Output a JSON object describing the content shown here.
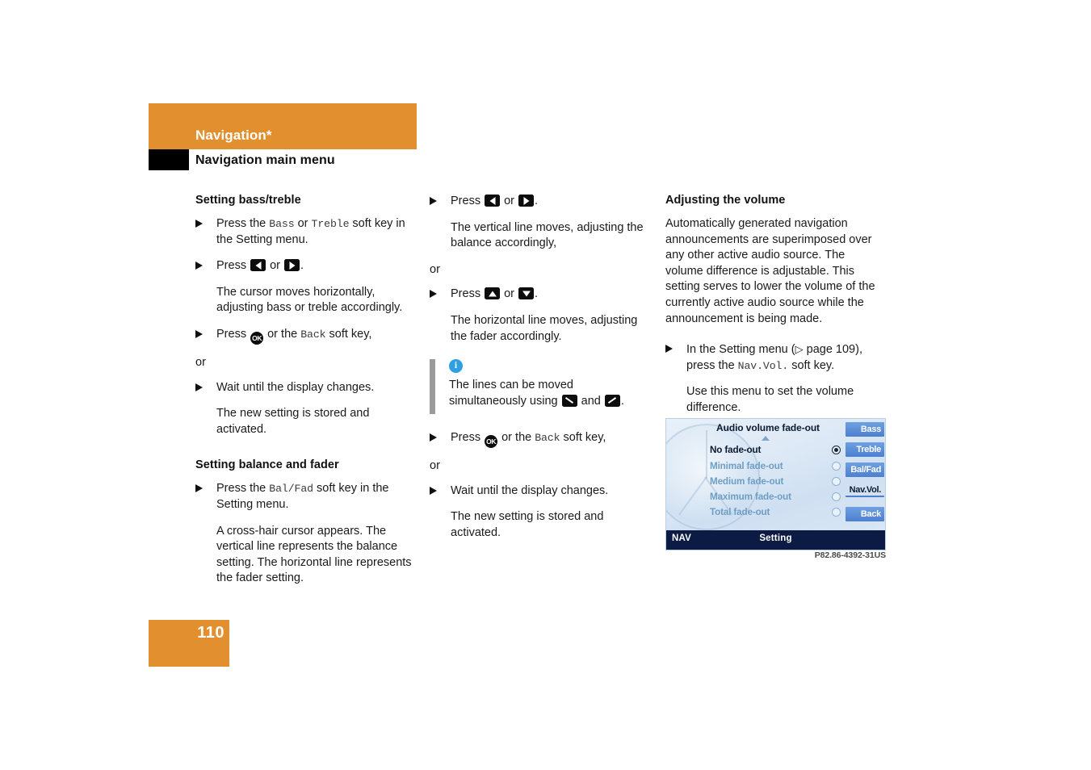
{
  "header": {
    "chapter": "Navigation*",
    "subtitle": "Navigation main menu"
  },
  "column1": {
    "section1_title": "Setting bass/treble",
    "s1_step1_pre": "Press the ",
    "s1_step1_key1": "Bass",
    "s1_step1_mid": " or ",
    "s1_step1_key2": "Treble",
    "s1_step1_post": " soft key in the Setting menu.",
    "s1_step2_pre": "Press ",
    "s1_step2_mid": " or ",
    "s1_step2_post": ".",
    "s1_result1": "The cursor moves horizontally, adjusting bass or treble accordingly.",
    "s1_step3_pre": "Press ",
    "s1_step3_mid": " or the ",
    "s1_step3_key": "Back",
    "s1_step3_post": " soft key,",
    "s1_or": "or",
    "s1_step4": "Wait until the display changes.",
    "s1_result2": "The new setting is stored and activated.",
    "section2_title": "Setting balance and fader",
    "s2_step1_pre": "Press the ",
    "s2_step1_key": "Bal/Fad",
    "s2_step1_post": " soft key in the Setting menu.",
    "s2_result1": "A cross-hair cursor appears. The vertical line represents the balance setting. The horizontal line represents the fader setting."
  },
  "column2": {
    "step1_pre": "Press ",
    "step1_mid": " or ",
    "step1_post": ".",
    "result1": "The vertical line moves, adjusting the balance accordingly,",
    "or1": "or",
    "step2_pre": "Press ",
    "step2_mid": " or ",
    "step2_post": ".",
    "result2": "The horizontal line moves, adjusting the fader accordingly.",
    "info_icon": "i",
    "info_pre": "The lines can be moved simultaneously using ",
    "info_mid": " and ",
    "info_post": ".",
    "step3_pre": "Press ",
    "step3_mid": " or the ",
    "step3_key": "Back",
    "step3_post": " soft key,",
    "or2": "or",
    "step4": "Wait until the display changes.",
    "result3": "The new setting is stored and activated."
  },
  "column3": {
    "section_title": "Adjusting the volume",
    "intro": "Automatically generated navigation announcements are superimposed over any other active audio source. The volume difference is adjustable. This setting serves to lower the volume of the currently active audio source while the announcement is being made.",
    "step1_pre": "In the Setting menu (",
    "step1_refarrow": "▷",
    "step1_ref": " page 109), press the ",
    "step1_key": "Nav.Vol.",
    "step1_post": " soft key.",
    "result1": "Use this menu to set the volume difference."
  },
  "nav_screen": {
    "title": "Audio volume fade-out",
    "options": [
      {
        "label": "No fade-out",
        "selected": true
      },
      {
        "label": "Minimal fade-out",
        "selected": false
      },
      {
        "label": "Medium fade-out",
        "selected": false
      },
      {
        "label": "Maximum fade-out",
        "selected": false
      },
      {
        "label": "Total fade-out",
        "selected": false
      }
    ],
    "softkeys": [
      {
        "label": "Bass",
        "active": false
      },
      {
        "label": "Treble",
        "active": false
      },
      {
        "label": "Bal/Fad",
        "active": false
      },
      {
        "label": "Nav.Vol.",
        "active": true
      },
      {
        "label": "Back",
        "active": false
      }
    ],
    "bottom_left": "NAV",
    "bottom_center": "Setting",
    "caption": "P82.86-4392-31US"
  },
  "footer": {
    "page_number": "110"
  },
  "colors": {
    "accent_orange": "#e2902f",
    "info_blue": "#2e9fe0",
    "softkey_blue": "#4c7fd0",
    "nav_bar_navy": "#0c1b43"
  }
}
